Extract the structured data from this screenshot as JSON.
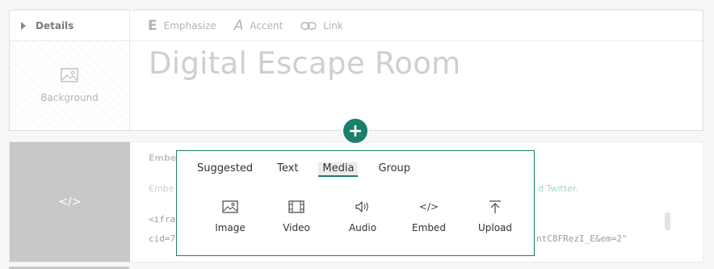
{
  "header": {
    "details_label": "Details",
    "background_label": "Background",
    "toolbar": {
      "emphasize": "Emphasize",
      "emphasize_glyph": "E",
      "accent": "Accent",
      "accent_glyph": "A",
      "link": "Link"
    },
    "title": "Digital Escape Room"
  },
  "embed_card": {
    "code_glyph": "</>",
    "title": "Embe",
    "desc": "Embe",
    "link_text": "d Twitter.",
    "code_line1": "<ifra",
    "code_line2": "cid=7",
    "code_line3": "ntC8FRezI_E&em=2\""
  },
  "add_button": {
    "glyph": "+"
  },
  "popup": {
    "tabs": [
      {
        "label": "Suggested"
      },
      {
        "label": "Text"
      },
      {
        "label": "Media",
        "active": true
      },
      {
        "label": "Group"
      }
    ],
    "items": [
      {
        "label": "Image",
        "icon": "image-icon"
      },
      {
        "label": "Video",
        "icon": "video-icon"
      },
      {
        "label": "Audio",
        "icon": "audio-icon"
      },
      {
        "label": "Embed",
        "icon": "embed-icon",
        "glyph": "</>"
      },
      {
        "label": "Upload",
        "icon": "upload-icon"
      }
    ]
  },
  "colors": {
    "accent": "#1a7f6b",
    "title": "#cfcfcf",
    "placeholder_gray": "#c8c8c8"
  }
}
